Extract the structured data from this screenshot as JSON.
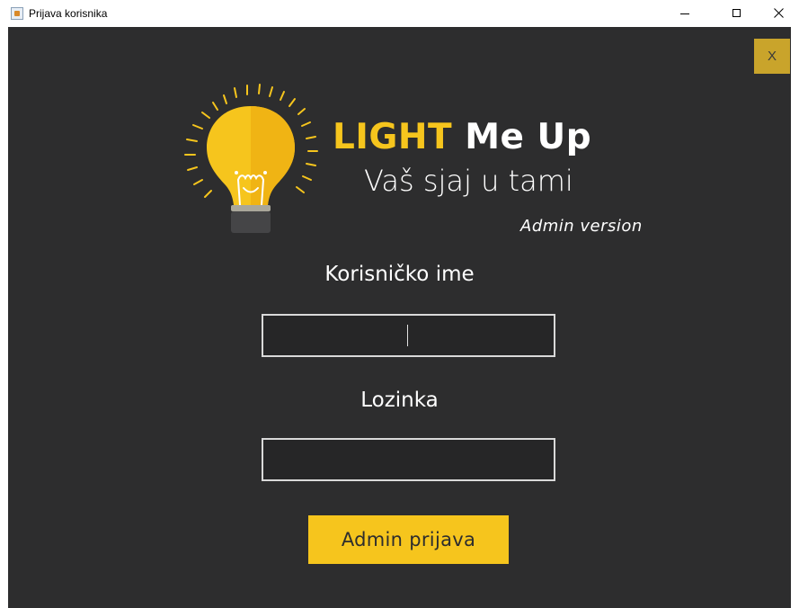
{
  "window": {
    "title": "Prijava korisnika",
    "icon": "java-cup-icon"
  },
  "panel": {
    "close_label": "X",
    "background": "#2d2d2e",
    "accent": "#f6c51d"
  },
  "logo": {
    "brand_light": "LIGHT",
    "brand_rest": " Me Up",
    "tagline": "Vaš sjaj u tami",
    "edition": "Admin version",
    "icon": "lightbulb-icon"
  },
  "form": {
    "username_label": "Korisničko ime",
    "username_value": "",
    "password_label": "Lozinka",
    "password_value": "",
    "submit_label": "Admin prijava"
  }
}
